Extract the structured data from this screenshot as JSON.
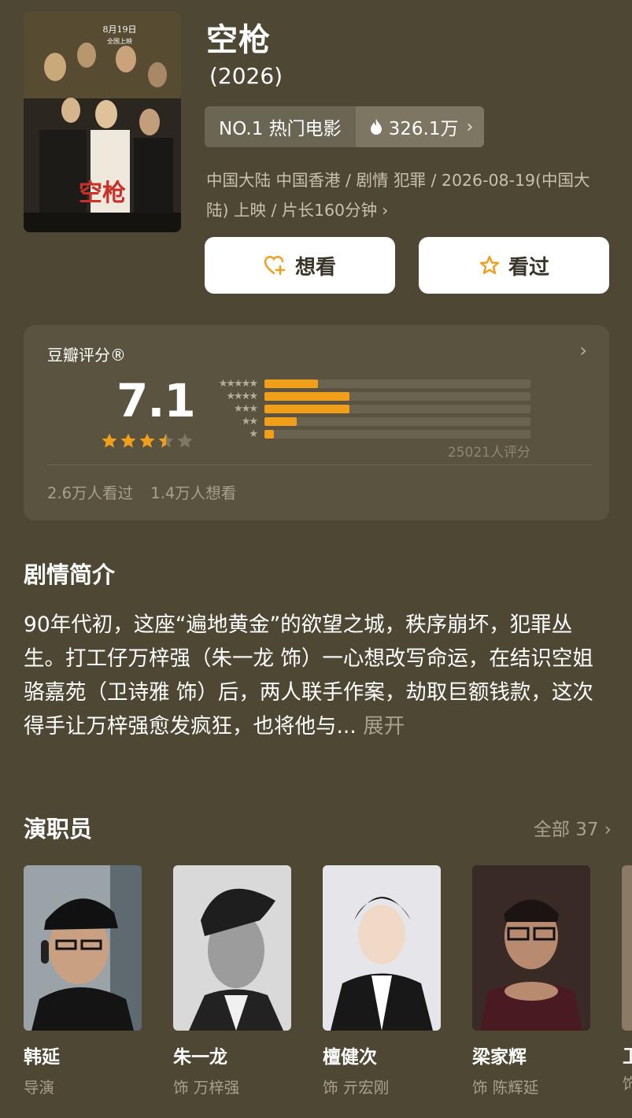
{
  "movie": {
    "title": "空枪",
    "year": "(2026)",
    "rank_label": "NO.1 热门电影",
    "heat": "326.1万",
    "meta": "中国大陆 中国香港 / 剧情 犯罪 / 2026-08-19(中国大陆) 上映 / 片长160分钟",
    "poster_title": "空枪",
    "poster_date": "8月19日",
    "poster_release": "全国上映"
  },
  "actions": {
    "want_label": "想看",
    "seen_label": "看过"
  },
  "rating": {
    "label": "豆瓣评分®",
    "score": "7.1",
    "stars": 3.5,
    "star_labels": [
      "★★★★★",
      "★★★★",
      "★★★",
      "★★",
      "★"
    ],
    "distribution": [
      0.2,
      0.32,
      0.32,
      0.12,
      0.035
    ],
    "count": "25021人评分",
    "watched": "2.6万人看过",
    "wants": "1.4万人想看",
    "colors": {
      "filled": "#f19e1b",
      "empty": "#7e7766"
    }
  },
  "synopsis": {
    "heading": "剧情简介",
    "text": "90年代初，这座“遍地黄金”的欲望之城，秩序崩坏，犯罪丛生。打工仔万梓强（朱一龙 饰）一心想改写命运，在结识空姐骆嘉苑（卫诗雅 饰）后，两人联手作案，劫取巨额钱款，这次得手让万梓强愈发疯狂，也将他与...",
    "expand": "展开"
  },
  "cast": {
    "heading": "演职员",
    "all_label": "全部 37",
    "members": [
      {
        "name": "韩延",
        "role": "导演"
      },
      {
        "name": "朱一龙",
        "role": "饰 万梓强"
      },
      {
        "name": "檀健次",
        "role": "饰 亓宏刚"
      },
      {
        "name": "梁家辉",
        "role": "饰 陈辉延"
      }
    ],
    "peek_name": "卫",
    "peek_role": "饰"
  }
}
